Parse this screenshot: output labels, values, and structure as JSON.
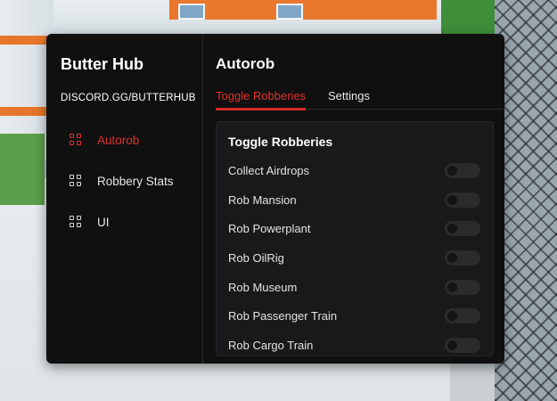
{
  "sidebar": {
    "title": "Butter Hub",
    "subtitle": "DISCORD.GG/BUTTERHUB",
    "items": [
      {
        "label": "Autorob",
        "icon": "grid-icon",
        "active": true
      },
      {
        "label": "Robbery Stats",
        "icon": "grid-icon",
        "active": false
      },
      {
        "label": "UI",
        "icon": "grid-icon",
        "active": false
      }
    ]
  },
  "main": {
    "title": "Autorob",
    "tabs": [
      {
        "label": "Toggle Robberies",
        "active": true
      },
      {
        "label": "Settings",
        "active": false
      }
    ],
    "section": {
      "title": "Toggle Robberies",
      "rows": [
        {
          "label": "Collect Airdrops",
          "enabled": false
        },
        {
          "label": "Rob Mansion",
          "enabled": false
        },
        {
          "label": "Rob Powerplant",
          "enabled": false
        },
        {
          "label": "Rob OilRig",
          "enabled": false
        },
        {
          "label": "Rob Museum",
          "enabled": false
        },
        {
          "label": "Rob Passenger Train",
          "enabled": false
        },
        {
          "label": "Rob Cargo Train",
          "enabled": false
        }
      ]
    }
  },
  "colors": {
    "accent": "#e0312b",
    "panel_bg": "#101011",
    "card_bg": "#19191b"
  }
}
